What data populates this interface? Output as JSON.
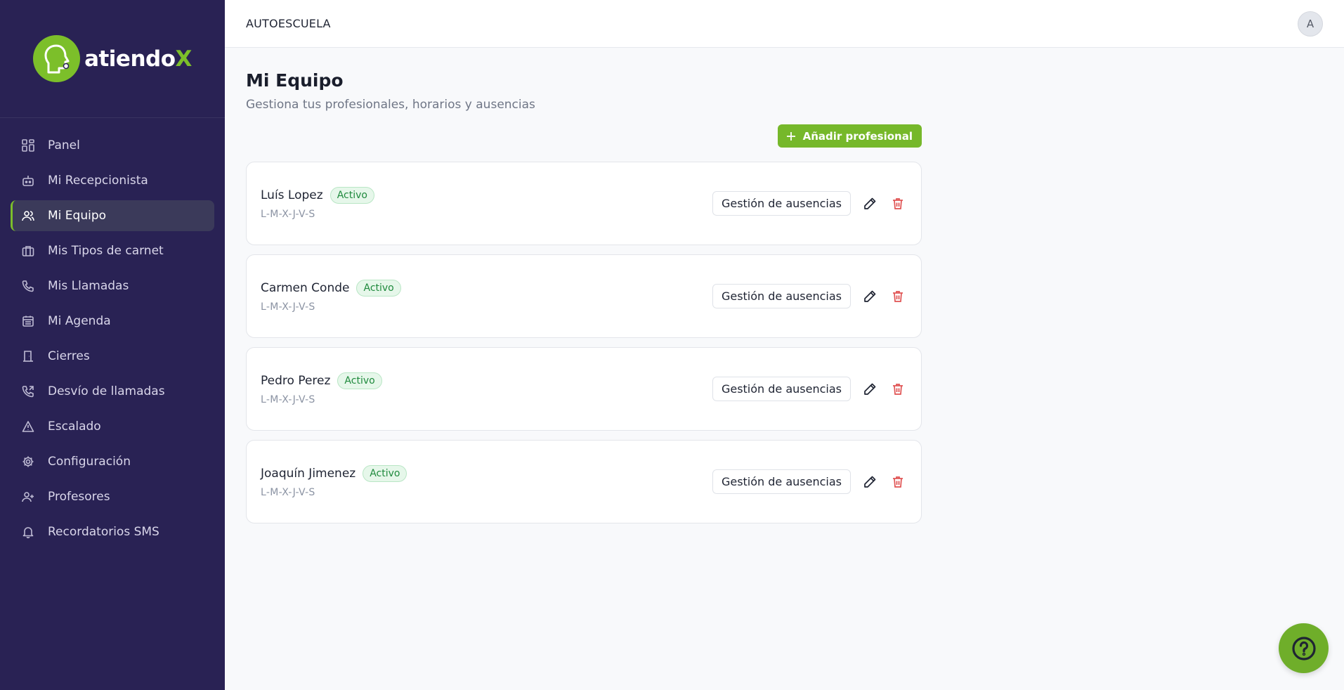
{
  "app": {
    "logo_text": "atiendo",
    "logo_accent": "X",
    "accent_color": "#76b82a",
    "sidebar_color": "#292254"
  },
  "sidebar": {
    "items": [
      {
        "label": "Panel",
        "icon": "grid-icon",
        "active": false
      },
      {
        "label": "Mi Recepcionista",
        "icon": "robot-icon",
        "active": false
      },
      {
        "label": "Mi Equipo",
        "icon": "users-icon",
        "active": true
      },
      {
        "label": "Mis Tipos de carnet",
        "icon": "briefcase-icon",
        "active": false
      },
      {
        "label": "Mis Llamadas",
        "icon": "phone-icon",
        "active": false
      },
      {
        "label": "Mi Agenda",
        "icon": "calendar-icon",
        "active": false
      },
      {
        "label": "Cierres",
        "icon": "door-icon",
        "active": false
      },
      {
        "label": "Desvío de llamadas",
        "icon": "phone-forward-icon",
        "active": false
      },
      {
        "label": "Escalado",
        "icon": "warning-icon",
        "active": false
      },
      {
        "label": "Configuración",
        "icon": "gear-icon",
        "active": false
      },
      {
        "label": "Profesores",
        "icon": "user-plus-icon",
        "active": false
      },
      {
        "label": "Recordatorios SMS",
        "icon": "bell-icon",
        "active": false
      }
    ]
  },
  "header": {
    "title": "AUTOESCUELA",
    "avatar_initial": "A"
  },
  "main": {
    "title": "Mi Equipo",
    "subtitle": "Gestiona tus profesionales, horarios y ausencias",
    "add_button_label": "Añadir profesional",
    "absence_button_label": "Gestión de ausencias",
    "professionals": [
      {
        "name": "Luís Lopez",
        "status": "Activo",
        "days": "L-M-X-J-V-S"
      },
      {
        "name": "Carmen Conde",
        "status": "Activo",
        "days": "L-M-X-J-V-S"
      },
      {
        "name": "Pedro Perez",
        "status": "Activo",
        "days": "L-M-X-J-V-S"
      },
      {
        "name": "Joaquín Jimenez",
        "status": "Activo",
        "days": "L-M-X-J-V-S"
      }
    ]
  }
}
